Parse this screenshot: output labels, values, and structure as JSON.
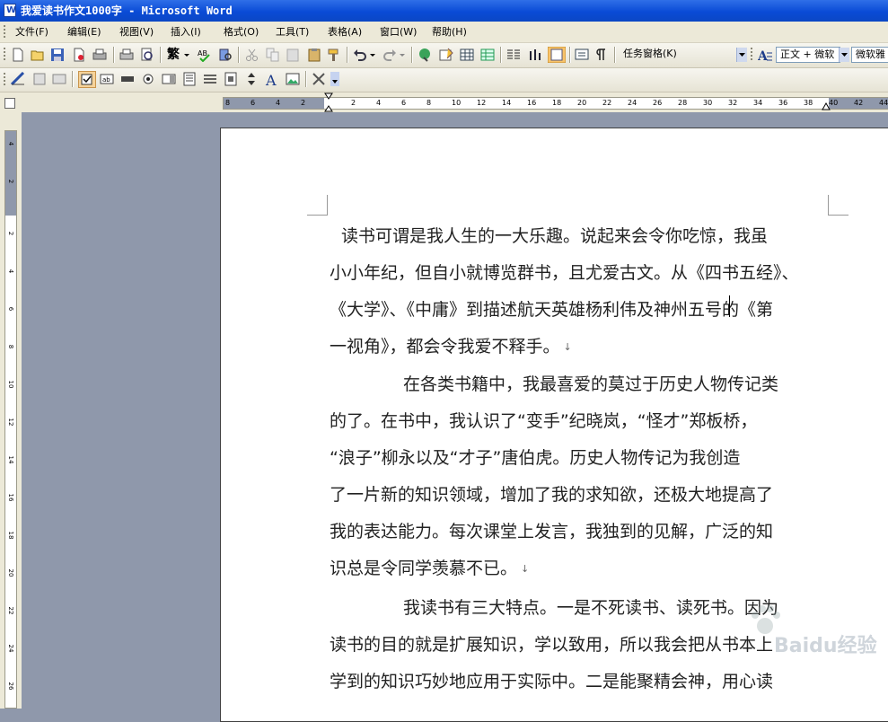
{
  "window": {
    "title": "我爱读书作文1000字 - Microsoft Word",
    "icon": "W"
  },
  "menu": {
    "items": [
      "文件(F)",
      "编辑(E)",
      "视图(V)",
      "插入(I)",
      "格式(O)",
      "工具(T)",
      "表格(A)",
      "窗口(W)",
      "帮助(H)"
    ]
  },
  "toolbar": {
    "task_pane": "任务窗格(K)",
    "style": "正文 + 微软",
    "font": "微软雅"
  },
  "icons": {
    "standard": [
      "new-icon",
      "open-icon",
      "save-icon",
      "permission-icon",
      "print-icon",
      "print-preview-icon",
      "spelling-icon",
      "research-icon",
      "cut-icon",
      "copy-icon",
      "paste-icon",
      "format-painter-icon",
      "undo-icon",
      "redo-icon",
      "hyperlink-icon",
      "tables-borders-icon",
      "insert-table-icon",
      "insert-excel-icon",
      "columns-icon",
      "drawing-icon",
      "document-map-icon",
      "show-hide-icon",
      "read-icon",
      "help-icon"
    ],
    "forms": [
      "ruler-tool-icon",
      "protect-icon",
      "form-fields-icon",
      "checkbox-icon",
      "textbox-icon",
      "combobox-icon",
      "radio-icon",
      "listbox-icon",
      "frame-icon",
      "table-icon",
      "scrollbar-icon",
      "spin-icon",
      "label-icon",
      "image-icon",
      "field-shading-icon",
      "tools-icon"
    ]
  },
  "conversion": {
    "label": "繁"
  },
  "ruler": {
    "horizontal_ticks": [
      "8",
      "6",
      "4",
      "2",
      "2",
      "4",
      "6",
      "8",
      "10",
      "12",
      "14",
      "16",
      "18",
      "20",
      "22",
      "24",
      "26",
      "28",
      "30",
      "32",
      "34",
      "36",
      "38",
      "40",
      "42",
      "44"
    ],
    "vertical_ticks": [
      "4",
      "2",
      "2",
      "4",
      "6",
      "8",
      "10",
      "12",
      "14",
      "16",
      "18",
      "20",
      "22",
      "24",
      "26"
    ]
  },
  "document": {
    "paragraphs": [
      {
        "lines": [
          "读书可谓是我人生的一大乐趣。说起来会令你吃惊，我虽",
          "小小年纪，但自小就博览群书，且尤爱古文。从《四书五经》、",
          "《大学》、《中庸》到描述航天英雄杨利伟及神州五号的《第",
          "一视角》，都会令我爱不释手。"
        ]
      },
      {
        "lines": [
          "在各类书籍中，我最喜爱的莫过于历史人物传记类",
          "的了。在书中，我认识了“变手”纪晓岚，“怪才”郑板桥，",
          "“浪子”柳永以及“才子”唐伯虎。历史人物传记为我创造",
          "了一片新的知识领域，增加了我的求知欲，还极大地提高了",
          "我的表达能力。每次课堂上发言，我独到的见解，广泛的知",
          "识总是令同学羡慕不已。"
        ]
      },
      {
        "lines": [
          "我读书有三大特点。一是不死读书、读死书。因为",
          "读书的目的就是扩展知识，学以致用，所以我会把从书本上",
          "学到的知识巧妙地应用于实际中。二是能聚精会神，用心读"
        ]
      }
    ],
    "return_mark": "↓"
  },
  "watermark": {
    "text": "Baidu经验"
  }
}
